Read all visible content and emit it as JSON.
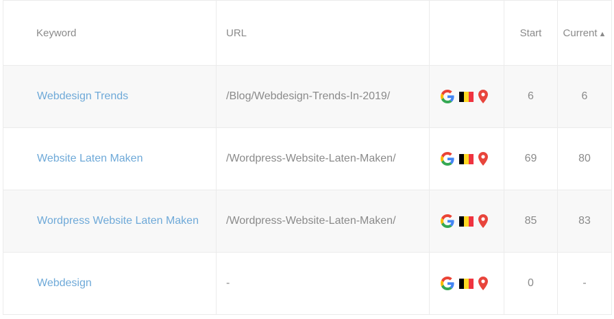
{
  "table": {
    "headers": {
      "keyword": "Keyword",
      "url": "URL",
      "start": "Start",
      "current": "Current",
      "sort_indicator": "▲"
    },
    "rows": [
      {
        "keyword": "Webdesign Trends",
        "url": "/Blog/Webdesign-Trends-In-2019/",
        "icons": [
          "google-icon",
          "belgium-flag-icon",
          "map-pin-icon"
        ],
        "start": "6",
        "current": "6"
      },
      {
        "keyword": "Website Laten Maken",
        "url": "/Wordpress-Website-Laten-Maken/",
        "icons": [
          "google-icon",
          "belgium-flag-icon",
          "map-pin-icon"
        ],
        "start": "69",
        "current": "80"
      },
      {
        "keyword": "Wordpress Website Laten Maken",
        "url": "/Wordpress-Website-Laten-Maken/",
        "icons": [
          "google-icon",
          "belgium-flag-icon",
          "map-pin-icon"
        ],
        "start": "85",
        "current": "83"
      },
      {
        "keyword": "Webdesign",
        "url": "-",
        "icons": [
          "google-icon",
          "belgium-flag-icon",
          "map-pin-icon"
        ],
        "start": "0",
        "current": "-"
      }
    ]
  },
  "colors": {
    "link": "#6ea9d8",
    "muted_text": "#8a8a8a",
    "row_shade": "#f8f8f8",
    "border": "#ebebeb",
    "pin_red": "#e8453c"
  }
}
